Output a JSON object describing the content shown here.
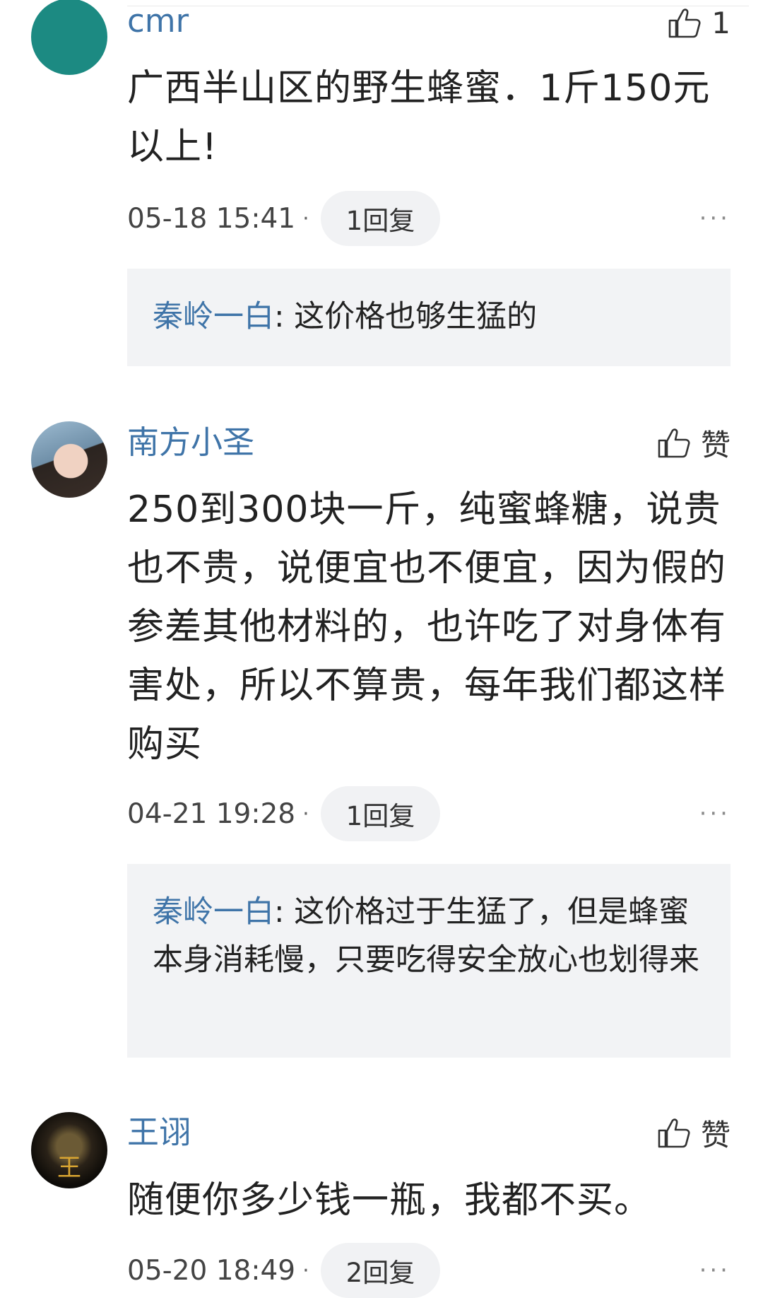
{
  "comments": [
    {
      "username": "cmr",
      "avatar_color": "#1c8a82",
      "like_label": "1",
      "text": "广西半山区的野生蜂蜜．1斤150元以上!",
      "time": "05-18 15:41",
      "replies_label": "1回复",
      "more": "···",
      "reply": {
        "name": "秦岭一白",
        "text": ": 这价格也够生猛的"
      }
    },
    {
      "username": "南方小圣",
      "like_label": "赞",
      "text": "250到300块一斤，纯蜜蜂糖，说贵也不贵，说便宜也不便宜，因为假的参差其他材料的，也许吃了对身体有害处，所以不算贵，每年我们都这样购买",
      "time": "04-21 19:28",
      "replies_label": "1回复",
      "more": "···",
      "reply": {
        "name": "秦岭一白",
        "text": ": 这价格过于生猛了，但是蜂蜜本身消耗慢，只要吃得安全放心也划得来"
      }
    },
    {
      "username": "王诩",
      "like_label": "赞",
      "avatar_glyph": "王",
      "text": "随便你多少钱一瓶，我都不买。",
      "time": "05-20 18:49",
      "replies_label": "2回复",
      "more": "···"
    }
  ],
  "colors": {
    "accent": "#3f74a8",
    "reply_bg": "#f2f3f5",
    "pill_bg": "#f1f2f4"
  }
}
